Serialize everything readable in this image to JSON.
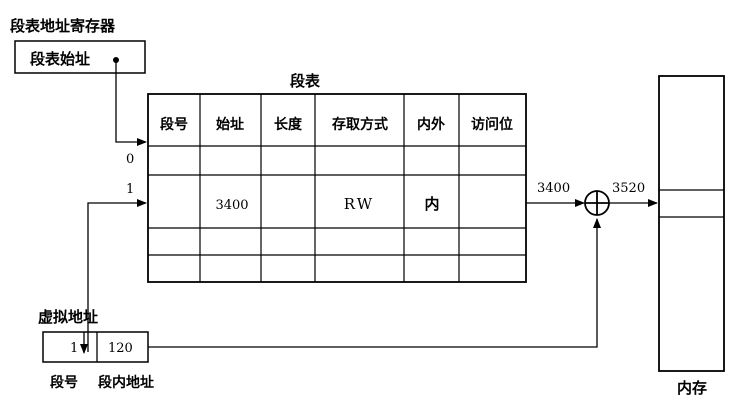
{
  "register": {
    "title": "段表地址寄存器",
    "content": "段表始址"
  },
  "segment_table": {
    "title": "段表",
    "headers": [
      "段号",
      "始址",
      "长度",
      "存取方式",
      "内外",
      "访问位"
    ],
    "row_labels": [
      "0",
      "1"
    ],
    "row1": {
      "start_address": "3400",
      "access_mode": "RW",
      "location": "内"
    }
  },
  "virtual_address": {
    "title": "虚拟地址",
    "segment_number": "1",
    "offset": "120",
    "segment_number_label": "段号",
    "offset_label": "段内地址"
  },
  "adder": {
    "input_value": "3400",
    "output_value": "3520",
    "symbol": "⊕"
  },
  "memory": {
    "label": "内存"
  }
}
